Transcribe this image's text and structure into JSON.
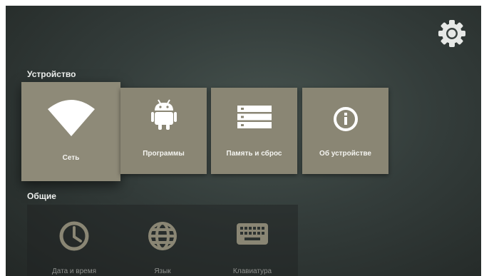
{
  "header": {
    "settings_icon": "gear-icon"
  },
  "sections": {
    "device": {
      "title": "Устройство",
      "items": [
        {
          "label": "Сеть",
          "icon": "wifi-icon"
        },
        {
          "label": "Программы",
          "icon": "android-icon"
        },
        {
          "label": "Память и сброс",
          "icon": "storage-icon"
        },
        {
          "label": "Об устройстве",
          "icon": "info-icon"
        }
      ]
    },
    "general": {
      "title": "Общие",
      "items": [
        {
          "label": "Дата и время",
          "icon": "clock-icon"
        },
        {
          "label": "Язык",
          "icon": "globe-icon"
        },
        {
          "label": "Клавиатура",
          "icon": "keyboard-icon"
        }
      ]
    }
  },
  "colors": {
    "tile": "#8a8674",
    "background": "#343d3b",
    "icon": "#ffffff",
    "dim_icon": "#8a8674"
  }
}
